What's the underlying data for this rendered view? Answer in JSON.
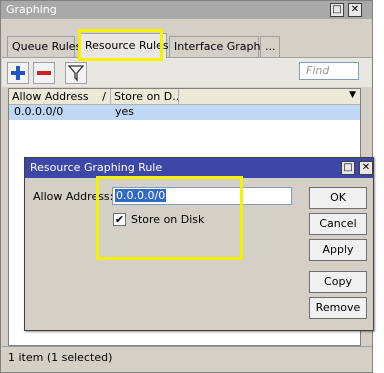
{
  "window": {
    "title": "Graphing",
    "max_glyph": "□",
    "close_glyph": "✕"
  },
  "tabs": [
    {
      "label": "Queue Rules"
    },
    {
      "label": "Resource Rules"
    },
    {
      "label": "Interface Graphs"
    },
    {
      "label": "..."
    }
  ],
  "toolbar": {
    "add_icon": "plus-icon",
    "remove_icon": "minus-icon",
    "filter_icon": "filter-icon",
    "find_placeholder": "Find",
    "dropdown_glyph": "▼"
  },
  "table": {
    "columns": [
      "Allow Address",
      "Store on D..."
    ],
    "sort_glyph": "/",
    "rows": [
      {
        "address": "0.0.0.0/0",
        "store": "yes"
      }
    ]
  },
  "status": "1 item (1 selected)",
  "dialog": {
    "title": "Resource Graphing Rule",
    "field_label": "Allow Address:",
    "field_value": "0.0.0.0/0",
    "checkbox_label": "Store on Disk",
    "checkbox_checked": true,
    "buttons": [
      "OK",
      "Cancel",
      "Apply",
      "Copy",
      "Remove"
    ]
  },
  "colors": {
    "highlight": "#f5f200",
    "dialog_title_bg": "#3c47a8",
    "selected_row": "#c0d8f4"
  }
}
